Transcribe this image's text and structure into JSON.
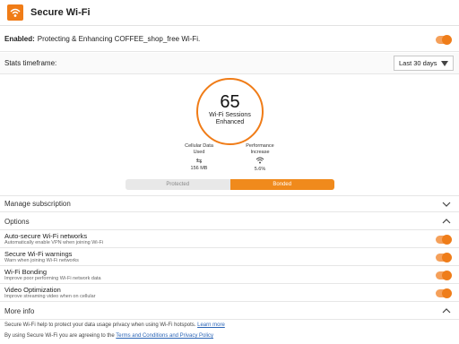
{
  "app": {
    "title": "Secure Wi-Fi",
    "icon": "wifi-shield-icon",
    "accent_color": "#f07c17"
  },
  "enabled": {
    "label": "Enabled:",
    "description": "Protecting & Enhancing COFFEE_shop_free Wi-Fi.",
    "on": true
  },
  "stats": {
    "label": "Stats timeframe:",
    "timeframe_selected": "Last 30 days"
  },
  "sessions": {
    "count": "65",
    "caption_line1": "Wi-Fi Sessions",
    "caption_line2": "Enhanced"
  },
  "metrics": [
    {
      "label_line1": "Cellular Data",
      "label_line2": "Used",
      "icon": "data-arrows-icon",
      "value": "156 MB"
    },
    {
      "label_line1": "Performance",
      "label_line2": "Increase",
      "icon": "wifi-icon",
      "value": "5.6%"
    }
  ],
  "mode": {
    "protected_label": "Protected",
    "bonded_label": "Bonded",
    "selected": "Bonded"
  },
  "manage_subscription": "Manage subscription",
  "options": {
    "header": "Options",
    "items": [
      {
        "title": "Auto-secure Wi-Fi networks",
        "subtitle": "Automatically enable VPN when joining Wi-Fi",
        "on": true
      },
      {
        "title": "Secure Wi-Fi warnings",
        "subtitle": "Warn when joining Wi-Fi networks",
        "on": true
      },
      {
        "title": "Wi-Fi Bonding",
        "subtitle": "Improve poor performing Wi-Fi network data",
        "on": true
      },
      {
        "title": "Video Optimization",
        "subtitle": "Improve streaming video when on cellular",
        "on": true
      }
    ]
  },
  "more_info": {
    "header": "More info",
    "line1_text": "Secure Wi-Fi help to protect your data usage privacy when using Wi-Fi hotspots.",
    "line1_link": "Learn more",
    "line2_text": "By using Secure Wi-Fi you are agreeing to the",
    "line2_link": "Terms and Conditions and Privacy Policy"
  }
}
